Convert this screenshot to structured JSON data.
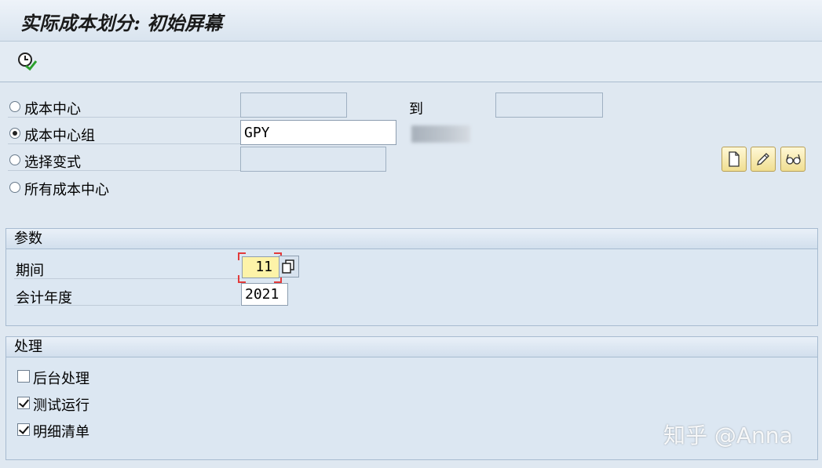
{
  "window": {
    "title": "实际成本划分: 初始屏幕"
  },
  "toolbar": {
    "execute_icon": "execute-clock-icon"
  },
  "selection": {
    "options": [
      {
        "label": "成本中心",
        "selected": false
      },
      {
        "label": "成本中心组",
        "selected": true
      },
      {
        "label": "选择变式",
        "selected": false
      },
      {
        "label": "所有成本中心",
        "selected": false
      }
    ],
    "to_label": "到",
    "cost_center_from": "",
    "cost_center_to": "",
    "cost_center_group": "GPY",
    "variant": ""
  },
  "variant_buttons": [
    "create-icon",
    "change-icon",
    "display-icon"
  ],
  "parameters": {
    "title": "参数",
    "period_label": "期间",
    "period_value": "11",
    "fiscal_year_label": "会计年度",
    "fiscal_year_value": "2021"
  },
  "processing": {
    "title": "处理",
    "options": [
      {
        "label": "后台处理",
        "checked": false
      },
      {
        "label": "测试运行",
        "checked": true
      },
      {
        "label": "明细清单",
        "checked": true
      }
    ]
  },
  "watermark": "知乎 @Anna",
  "colors": {
    "background": "#dfe8f1",
    "input_bg": "#dde7f1",
    "focus": "#e23b3b",
    "highlight": "#fdf3a8"
  }
}
